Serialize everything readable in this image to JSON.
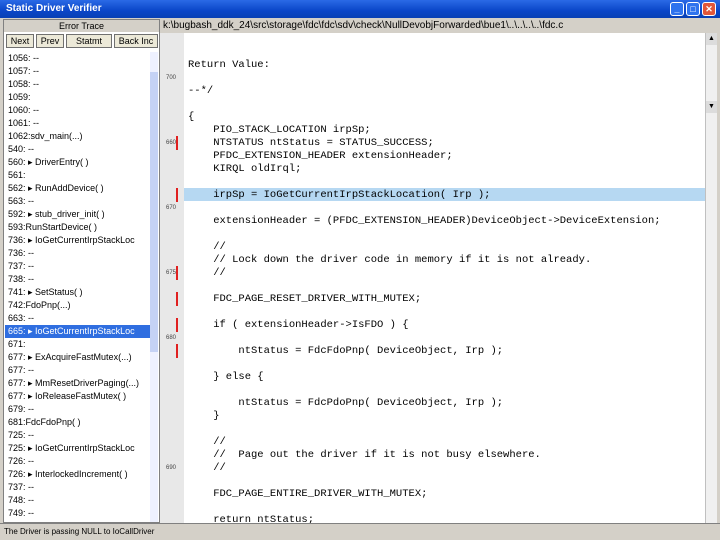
{
  "window": {
    "title": "Static Driver Verifier"
  },
  "trace_panel": {
    "header": "Error Trace",
    "nav": [
      "Next",
      "Prev",
      "Statmt",
      "Back Inc"
    ],
    "rows": [
      "1056: --",
      "1057: --",
      "1058: --",
      "1059:",
      "1060: --",
      "1061: --",
      "1062:sdv_main(...)",
      "540: --",
      "560: ▸ DriverEntry( )",
      "561:",
      "562: ▸ RunAddDevice( )",
      "563: --",
      "592: ▸ stub_driver_init( )",
      "593:RunStartDevice( )",
      "736: ▸ IoGetCurrentIrpStackLoc",
      "736: --",
      "737: --",
      "738: --",
      "741: ▸ SetStatus( )",
      "742:FdoPnp(...)",
      "663: --",
      "665: ▸ IoGetCurrentIrpStackLoc",
      "671:",
      "677: ▸ ExAcquireFastMutex(...)",
      "677: --",
      "677: ▸ MmResetDriverPaging(...)",
      "677: ▸ IoReleaseFastMutex( )",
      "679: --",
      "681:FdcFdoPnp( )",
      "725: --",
      "725: ▸ IoGetCurrentIrpStackLoc",
      "726: --",
      "726: ▸ InterlockedIncrement( )",
      "737: --",
      "748: --",
      "749: --"
    ],
    "selected_index": 21
  },
  "editor": {
    "path": "k:\\bugbash_ddk_24\\src\\storage\\fdc\\fdc\\sdv\\check\\NullDevobjForwarded\\bue1\\..\\..\\..\\..\\fdc.c",
    "lines": [
      "Return Value:",
      "",
      "--*/",
      "",
      "{",
      "    PIO_STACK_LOCATION irpSp;",
      "    NTSTATUS ntStatus = STATUS_SUCCESS;",
      "    PFDC_EXTENSION_HEADER extensionHeader;",
      "    KIRQL oldIrql;",
      "",
      "    irpSp = IoGetCurrentIrpStackLocation( Irp );",
      "",
      "    extensionHeader = (PFDC_EXTENSION_HEADER)DeviceObject->DeviceExtension;",
      "",
      "    //",
      "    // Lock down the driver code in memory if it is not already.",
      "    //",
      "",
      "    FDC_PAGE_RESET_DRIVER_WITH_MUTEX;",
      "",
      "    if ( extensionHeader->IsFDO ) {",
      "",
      "        ntStatus = FdcFdoPnp( DeviceObject, Irp );",
      "",
      "    } else {",
      "",
      "        ntStatus = FdcPdoPnp( DeviceObject, Irp );",
      "    }",
      "",
      "    //",
      "    //  Page out the driver if it is not busy elsewhere.",
      "    //",
      "",
      "    FDC_PAGE_ENTIRE_DRIVER_WITH_MUTEX;",
      "",
      "    return ntStatus;"
    ],
    "highlight_line": 10,
    "gutter_numbers": [
      {
        "line": 1,
        "text": "700"
      },
      {
        "line": 6,
        "text": "660"
      },
      {
        "line": 11,
        "text": "670"
      },
      {
        "line": 16,
        "text": "675"
      },
      {
        "line": 21,
        "text": "680"
      },
      {
        "line": 31,
        "text": "690"
      }
    ],
    "red_marks": [
      6,
      10,
      16,
      18,
      20,
      22
    ]
  },
  "status": {
    "text": "The Driver is passing NULL to IoCallDriver"
  },
  "colors": {
    "selection": "#2f6ee0",
    "highlight": "#b6d8f2",
    "mark": "#e02020"
  }
}
